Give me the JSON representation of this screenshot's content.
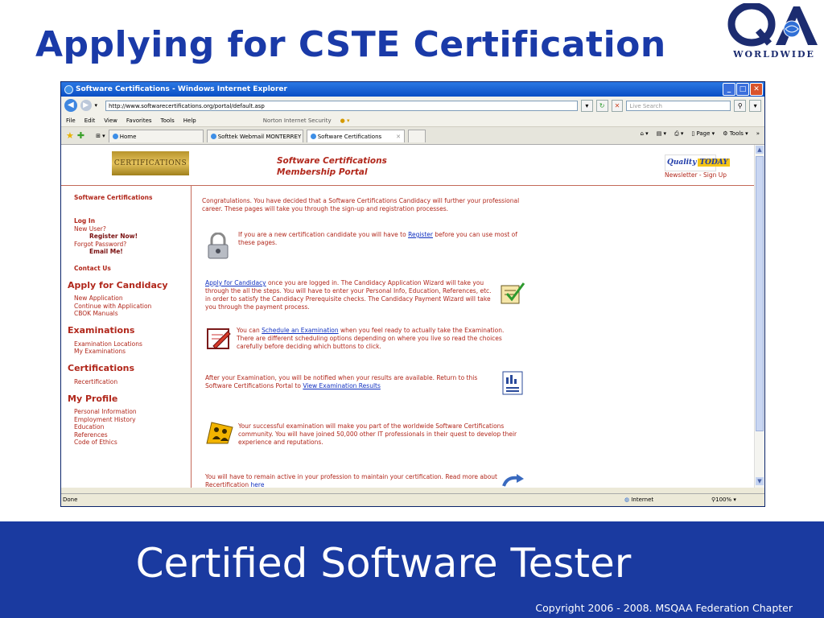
{
  "slide": {
    "title": "Applying for CSTE Certification",
    "logo_text": "WORLDWIDE",
    "footer_title": "Certified Software Tester",
    "copyright": "Copyright 2006 - 2008. MSQAA Federation Chapter"
  },
  "browser": {
    "window_title": "Software Certifications - Windows Internet Explorer",
    "address": "http://www.softwarecertifications.org/portal/default.asp",
    "search_placeholder": "Live Search",
    "menu": [
      "File",
      "Edit",
      "View",
      "Favorites",
      "Tools",
      "Help"
    ],
    "norton": "Norton Internet Security",
    "tabs": [
      {
        "label": "Home",
        "active": false
      },
      {
        "label": "Softtek Webmail MONTERREY",
        "active": false
      },
      {
        "label": "Software Certifications",
        "active": true
      }
    ],
    "command_bar": {
      "page": "Page",
      "tools": "Tools"
    },
    "status": {
      "left": "Done",
      "zone": "Internet",
      "zoom": "100%"
    }
  },
  "page": {
    "cert_logo": "CERTIFICATIONS",
    "portal_title_1": "Software Certifications",
    "portal_title_2": "Membership Portal",
    "qt_logo_a": "Quality",
    "qt_logo_b": "TODAY",
    "newsletter": "Newsletter - Sign Up",
    "sidebar": {
      "software_certifications": "Software Certifications",
      "log_in": "Log In",
      "new_user": "New User?",
      "register_now": "Register Now!",
      "forgot_password": "Forgot Password?",
      "email_me": "Email Me!",
      "contact_us": "Contact Us",
      "apply_heading": "Apply for Candidacy",
      "apply_items": [
        "New Application",
        "Continue with Application",
        "CBOK Manuals"
      ],
      "exam_heading": "Examinations",
      "exam_items": [
        "Examination Locations",
        "My Examinations"
      ],
      "cert_heading": "Certifications",
      "cert_items": [
        "Recertification"
      ],
      "profile_heading": "My Profile",
      "profile_items": [
        "Personal Information",
        "Employment History",
        "Education",
        "References",
        "Code of Ethics"
      ]
    },
    "content": {
      "intro": "Congratulations. You have decided that a Software Certifications Candidacy will further your professional career. These pages will take you through the sign-up and registration processes.",
      "register_pre": "If you are a new certification candidate you will have to ",
      "register_link": "Register",
      "register_post": " before you can use most of these pages.",
      "apply_link": "Apply for Candidacy",
      "apply_post": " once you are logged in. The Candidacy Application Wizard will take you through the all the steps. You will have to enter your Personal Info, Education, References, etc. in order to satisfy the Candidacy Prerequisite checks. The Candidacy Payment Wizard will take you through the payment process.",
      "schedule_pre": "You can ",
      "schedule_link": "Schedule an Examination",
      "schedule_post": " when you feel ready to actually take the Examination. There are different scheduling options depending on where you live so read the choices carefully before deciding which buttons to click.",
      "results_pre": "After your Examination, you will be notified when your results are available. Return to this Software Certifications Portal to ",
      "results_link": "View Examination Results",
      "community": "Your successful examination will make you part of the worldwide Software Certifications community. You will have joined 50,000 other IT professionals in their quest to develop their experience and reputations.",
      "recert_pre": "You will have to remain active in your profession to maintain your certification. Read more about Recertification ",
      "recert_link": "here"
    }
  }
}
